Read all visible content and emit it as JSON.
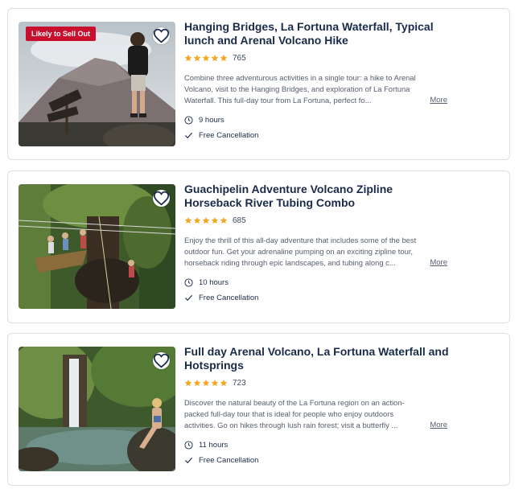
{
  "tours": [
    {
      "badge": "Likely to Sell Out",
      "title": "Hanging Bridges, La Fortuna Waterfall, Typical lunch and Arenal Volcano Hike",
      "rating": 5,
      "reviews": "765",
      "description": "Combine three adventurous activities in a single tour: a hike to Arenal Volcano, visit to the Hanging Bridges, and exploration of La Fortuna Waterfall. This full-day tour from La Fortuna, perfect fo...",
      "more": "More",
      "duration": "9 hours",
      "cancellation": "Free Cancellation"
    },
    {
      "badge": "",
      "title": "Guachipelin Adventure Volcano Zipline Horseback River Tubing Combo",
      "rating": 5,
      "reviews": "685",
      "description": "Enjoy the thrill of this all-day adventure that includes some of the best outdoor fun. Get your adrenaline pumping on an exciting zipline tour, horseback riding through epic landscapes, and tubing along c...",
      "more": "More",
      "duration": "10 hours",
      "cancellation": "Free Cancellation"
    },
    {
      "badge": "",
      "title": "Full day Arenal Volcano, La Fortuna Waterfall and Hotsprings",
      "rating": 5,
      "reviews": "723",
      "description": "Discover the natural beauty of the La Fortuna region on an action-packed full-day tour that is ideal for people who enjoy outdoors activities. Go on hikes through lush rain forest; visit a butterfly ...",
      "more": "More",
      "duration": "11 hours",
      "cancellation": "Free Cancellation"
    }
  ],
  "icons": {
    "favorite": "heart-icon",
    "star": "star-icon",
    "duration": "clock-icon",
    "cancellation": "check-icon"
  },
  "colors": {
    "badge_bg": "#c8102e",
    "star": "#f5a623",
    "text": "#1a2b49"
  }
}
